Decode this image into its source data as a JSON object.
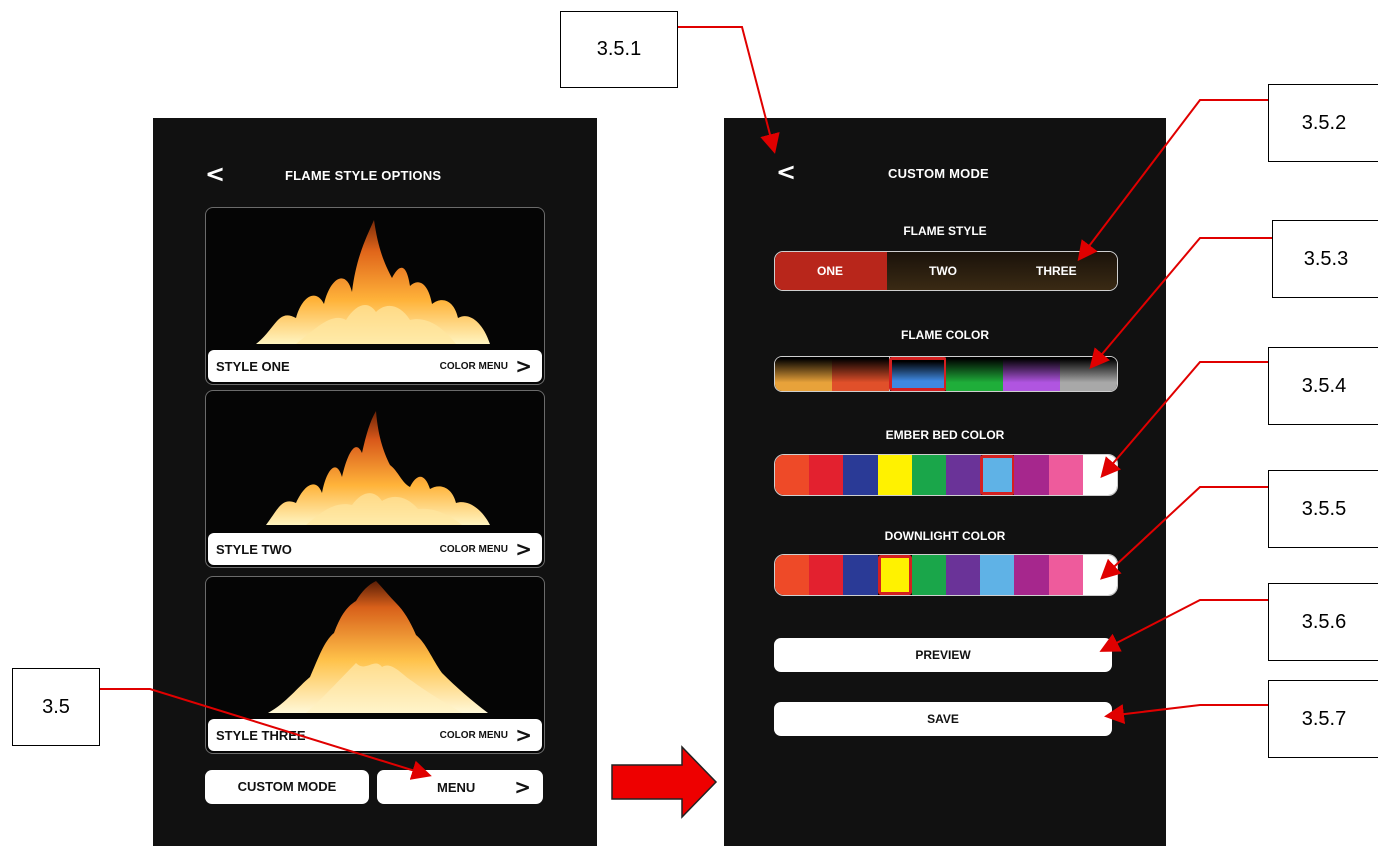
{
  "left_screen": {
    "back_glyph": "<",
    "title": "FLAME STYLE OPTIONS",
    "cards": [
      {
        "label": "STYLE ONE",
        "action": "COLOR MENU",
        "chevron": ">"
      },
      {
        "label": "STYLE TWO",
        "action": "COLOR MENU",
        "chevron": ">"
      },
      {
        "label": "STYLE THREE",
        "action": "COLOR MENU",
        "chevron": ">"
      }
    ],
    "custom_mode_button": "CUSTOM MODE",
    "menu_button": "MENU",
    "menu_chevron": ">"
  },
  "right_screen": {
    "back_glyph": "<",
    "title": "CUSTOM MODE",
    "flame_style": {
      "label": "FLAME STYLE",
      "options": [
        "ONE",
        "TWO",
        "THREE"
      ],
      "selected": "ONE",
      "selected_color": "#b8261b"
    },
    "flame_color": {
      "label": "FLAME COLOR",
      "swatches": [
        "#e8a23a",
        "#e0502a",
        "#3f88e0",
        "#1fae3a",
        "#b055e0",
        "#a8a8a8"
      ],
      "selected_index": 2
    },
    "ember_bed_color": {
      "label": "EMBER BED COLOR",
      "swatches": [
        "#ee4a28",
        "#e3212f",
        "#2a3a96",
        "#fff200",
        "#1aa64a",
        "#6a3398",
        "#5fb2e6",
        "#a6278d",
        "#ee5b9c",
        "#ffffff"
      ],
      "selected_index": 6
    },
    "downlight_color": {
      "label": "DOWNLIGHT COLOR",
      "swatches": [
        "#ee4a28",
        "#e3212f",
        "#2a3a96",
        "#fff200",
        "#1aa64a",
        "#6a3398",
        "#5fb2e6",
        "#a6278d",
        "#ee5b9c",
        "#ffffff"
      ],
      "selected_index": 3
    },
    "preview_button": "PREVIEW",
    "save_button": "SAVE"
  },
  "callouts": {
    "c35": "3.5",
    "c351": "3.5.1",
    "c352": "3.5.2",
    "c353": "3.5.3",
    "c354": "3.5.4",
    "c355": "3.5.5",
    "c356": "3.5.6",
    "c357": "3.5.7"
  },
  "colors": {
    "annotation_red": "#e00000",
    "screen_bg": "#111111",
    "selection_outline": "#d42020"
  }
}
